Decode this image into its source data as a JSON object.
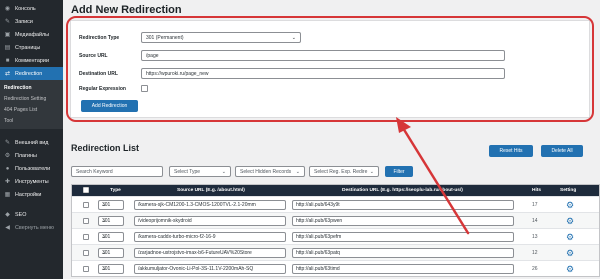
{
  "sidebar": {
    "items": [
      {
        "label": "Консоль",
        "icon": "dashboard-icon",
        "glyph": "◉"
      },
      {
        "label": "Записи",
        "icon": "pin-icon",
        "glyph": "✎"
      },
      {
        "label": "Медиафайлы",
        "icon": "media-icon",
        "glyph": "▣"
      },
      {
        "label": "Страницы",
        "icon": "pages-icon",
        "glyph": "▤"
      },
      {
        "label": "Комментарии",
        "icon": "comments-icon",
        "glyph": "■"
      },
      {
        "label": "Redirection",
        "icon": "redirection-icon",
        "glyph": "⇄"
      }
    ],
    "submenu": [
      "Redirection",
      "Redirection Setting",
      "404 Pages List",
      "Tool"
    ],
    "items2": [
      {
        "label": "Внешний вид",
        "icon": "appearance-icon",
        "glyph": "✎"
      },
      {
        "label": "Плагины",
        "icon": "plugins-icon",
        "glyph": "⚙"
      },
      {
        "label": "Пользователи",
        "icon": "users-icon",
        "glyph": "●"
      },
      {
        "label": "Инструменты",
        "icon": "tools-icon",
        "glyph": "✚"
      },
      {
        "label": "Настройки",
        "icon": "settings-icon",
        "glyph": "▦"
      }
    ],
    "seo": {
      "label": "SEO",
      "icon": "seo-icon",
      "glyph": "◆"
    },
    "collapse": {
      "label": "Свернуть меню",
      "icon": "collapse-icon",
      "glyph": "◀"
    }
  },
  "form": {
    "title": "Add New Redirection",
    "redirection_type_label": "Redirection Type",
    "redirection_type_value": "301 (Permanent)",
    "source_label": "Source URL",
    "source_value": "/page",
    "destination_label": "Destination URL",
    "destination_value": "https://wpuroki.ru/page_new",
    "regex_label": "Regular Expression",
    "add_button": "Add Redirection"
  },
  "list": {
    "title": "Redirection List",
    "reset_hits": "Reset Hits",
    "delete_all": "Delete All",
    "search_placeholder": "Search Keyword",
    "select_type": "Select Type",
    "select_hidden": "Select Hidden Records",
    "select_regexp": "Select Reg. Exp. Redire",
    "filter_button": "Filter",
    "columns": {
      "type": "Type",
      "source": "Source URL (E.g. /about.html)",
      "destination": "Destination URL (E.g. https://seoplu-lab.ru/about-us/)",
      "hits": "Hits",
      "setting": "Setting"
    },
    "rows": [
      {
        "type": "301",
        "source": "/kamera-sjk-CM1200-1.3-CMOS-1200TVL-2.1-20mm",
        "destination": "http://ali.pub/643y9t",
        "hits": "17"
      },
      {
        "type": "301",
        "source": "/videoprijomnik-skydroid",
        "destination": "http://ali.pub/63pwen",
        "hits": "14"
      },
      {
        "type": "301",
        "source": "/kamera-caddx-turbo-micro-f2-16-9",
        "destination": "http://ali.pub/63pefm",
        "hits": "13"
      },
      {
        "type": "301",
        "source": "/zarjadnoe-ustrojstvo-imax-b6-FutureUAV%20Store",
        "destination": "http://ali.pub/63patq",
        "hits": "12"
      },
      {
        "type": "301",
        "source": "/akkumuljator-Ovonic-Li-Pol-3S-11.1V-2200mAh-SQ",
        "destination": "http://ali.pub/63timd",
        "hits": "26"
      }
    ]
  }
}
